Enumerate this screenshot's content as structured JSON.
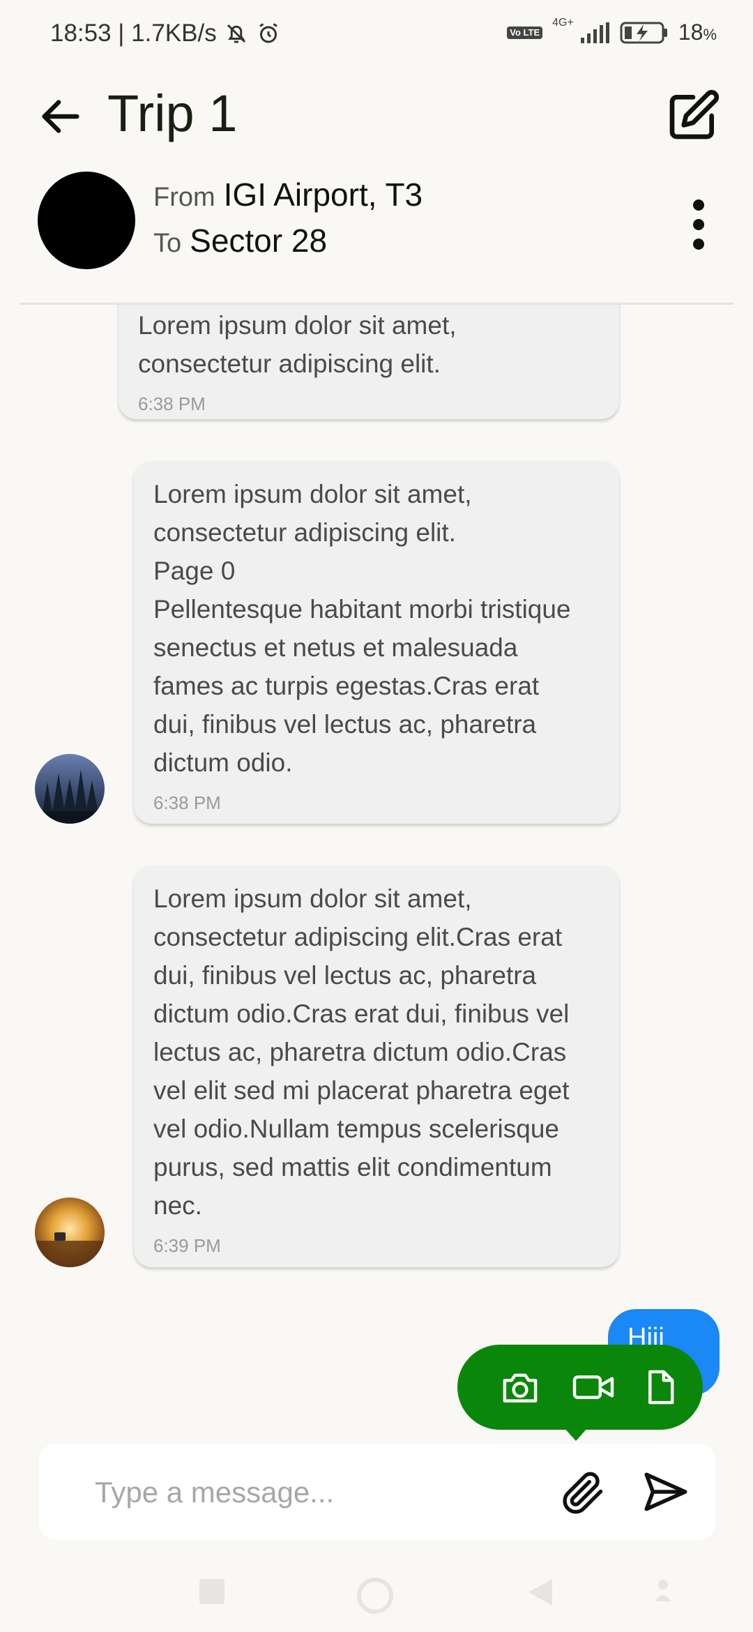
{
  "status_bar": {
    "time_speed": "18:53 | 1.7KB/s",
    "volte": "Vo LTE",
    "network": "4G+",
    "battery": "18",
    "battery_unit": "%"
  },
  "header": {
    "title": "Trip 1"
  },
  "trip": {
    "from_label": "From",
    "from_value": "IGI Airport, T3",
    "to_label": "To",
    "to_value": "Sector 28"
  },
  "messages": [
    {
      "lines": [
        "Lorem ipsum dolor sit amet,",
        "consectetur adipiscing elit."
      ],
      "time": "6:38 PM"
    },
    {
      "lines": [
        "Lorem ipsum dolor sit amet,",
        "consectetur adipiscing elit.",
        "Page 0",
        "Pellentesque habitant morbi tristique",
        "senectus et netus et malesuada",
        "fames ac turpis egestas.Cras erat",
        "dui, finibus vel lectus ac, pharetra",
        "dictum odio."
      ],
      "time": "6:38 PM"
    },
    {
      "lines": [
        "Lorem ipsum dolor sit amet,",
        "consectetur adipiscing elit.Cras erat",
        "dui, finibus vel lectus ac, pharetra",
        "dictum odio.Cras erat dui, finibus vel",
        "lectus ac, pharetra dictum odio.Cras",
        "vel elit sed mi placerat pharetra eget",
        "vel odio.Nullam tempus scelerisque",
        "purus, sed mattis elit condimentum",
        "nec."
      ],
      "time": "6:39 PM"
    }
  ],
  "sent_message": "Hiii",
  "composer": {
    "placeholder": "Type a message..."
  },
  "colors": {
    "popup": "#0a870a",
    "sent_bubble": "#1a88f5",
    "background": "#f9f8f5"
  },
  "icons": [
    "back-arrow-icon",
    "edit-icon",
    "more-vert-icon",
    "camera-icon",
    "video-icon",
    "document-icon",
    "attach-icon",
    "send-icon"
  ]
}
